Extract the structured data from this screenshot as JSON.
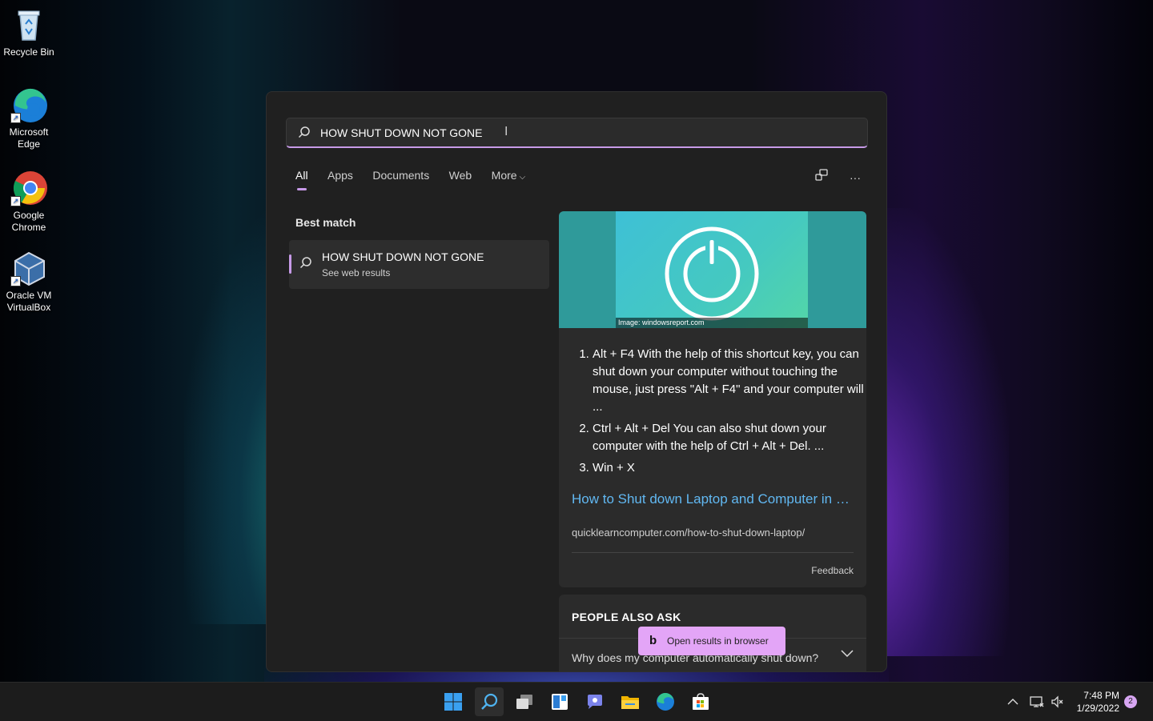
{
  "desktop": {
    "icons": [
      {
        "label": "Recycle Bin"
      },
      {
        "label": "Microsoft Edge"
      },
      {
        "label": "Google Chrome"
      },
      {
        "label": "Oracle VM VirtualBox"
      }
    ]
  },
  "search": {
    "query": "HOW SHUT DOWN NOT GONE",
    "tabs": [
      "All",
      "Apps",
      "Documents",
      "Web",
      "More"
    ],
    "active_tab": "All"
  },
  "best_match": {
    "heading": "Best match",
    "title": "HOW SHUT DOWN NOT GONE",
    "subtitle": "See web results"
  },
  "result_card": {
    "image_credit": "Image: windowsreport.com",
    "steps": [
      "Alt + F4 With the help of this shortcut key, you can shut down your computer without touching the mouse, just press \"Alt + F4\" and your computer will ...",
      "Ctrl + Alt + Del You can also shut down your computer with the help of Ctrl + Alt + Del. ...",
      "Win + X"
    ],
    "link_text": "How to Shut down Laptop and Computer in …",
    "url": "quicklearncomputer.com/how-to-shut-down-laptop/",
    "feedback": "Feedback"
  },
  "people_also_ask": {
    "heading": "PEOPLE ALSO ASK",
    "question": "Why does my computer automatically shut down?"
  },
  "open_browser": {
    "icon_letter": "b",
    "label": "Open results in browser"
  },
  "taskbar": {
    "time": "7:48 PM",
    "date": "1/29/2022",
    "notification_count": "2"
  },
  "colors": {
    "accent": "#c79ae8",
    "link": "#61b8f2",
    "open_browser_bg": "#e3a5f7"
  }
}
